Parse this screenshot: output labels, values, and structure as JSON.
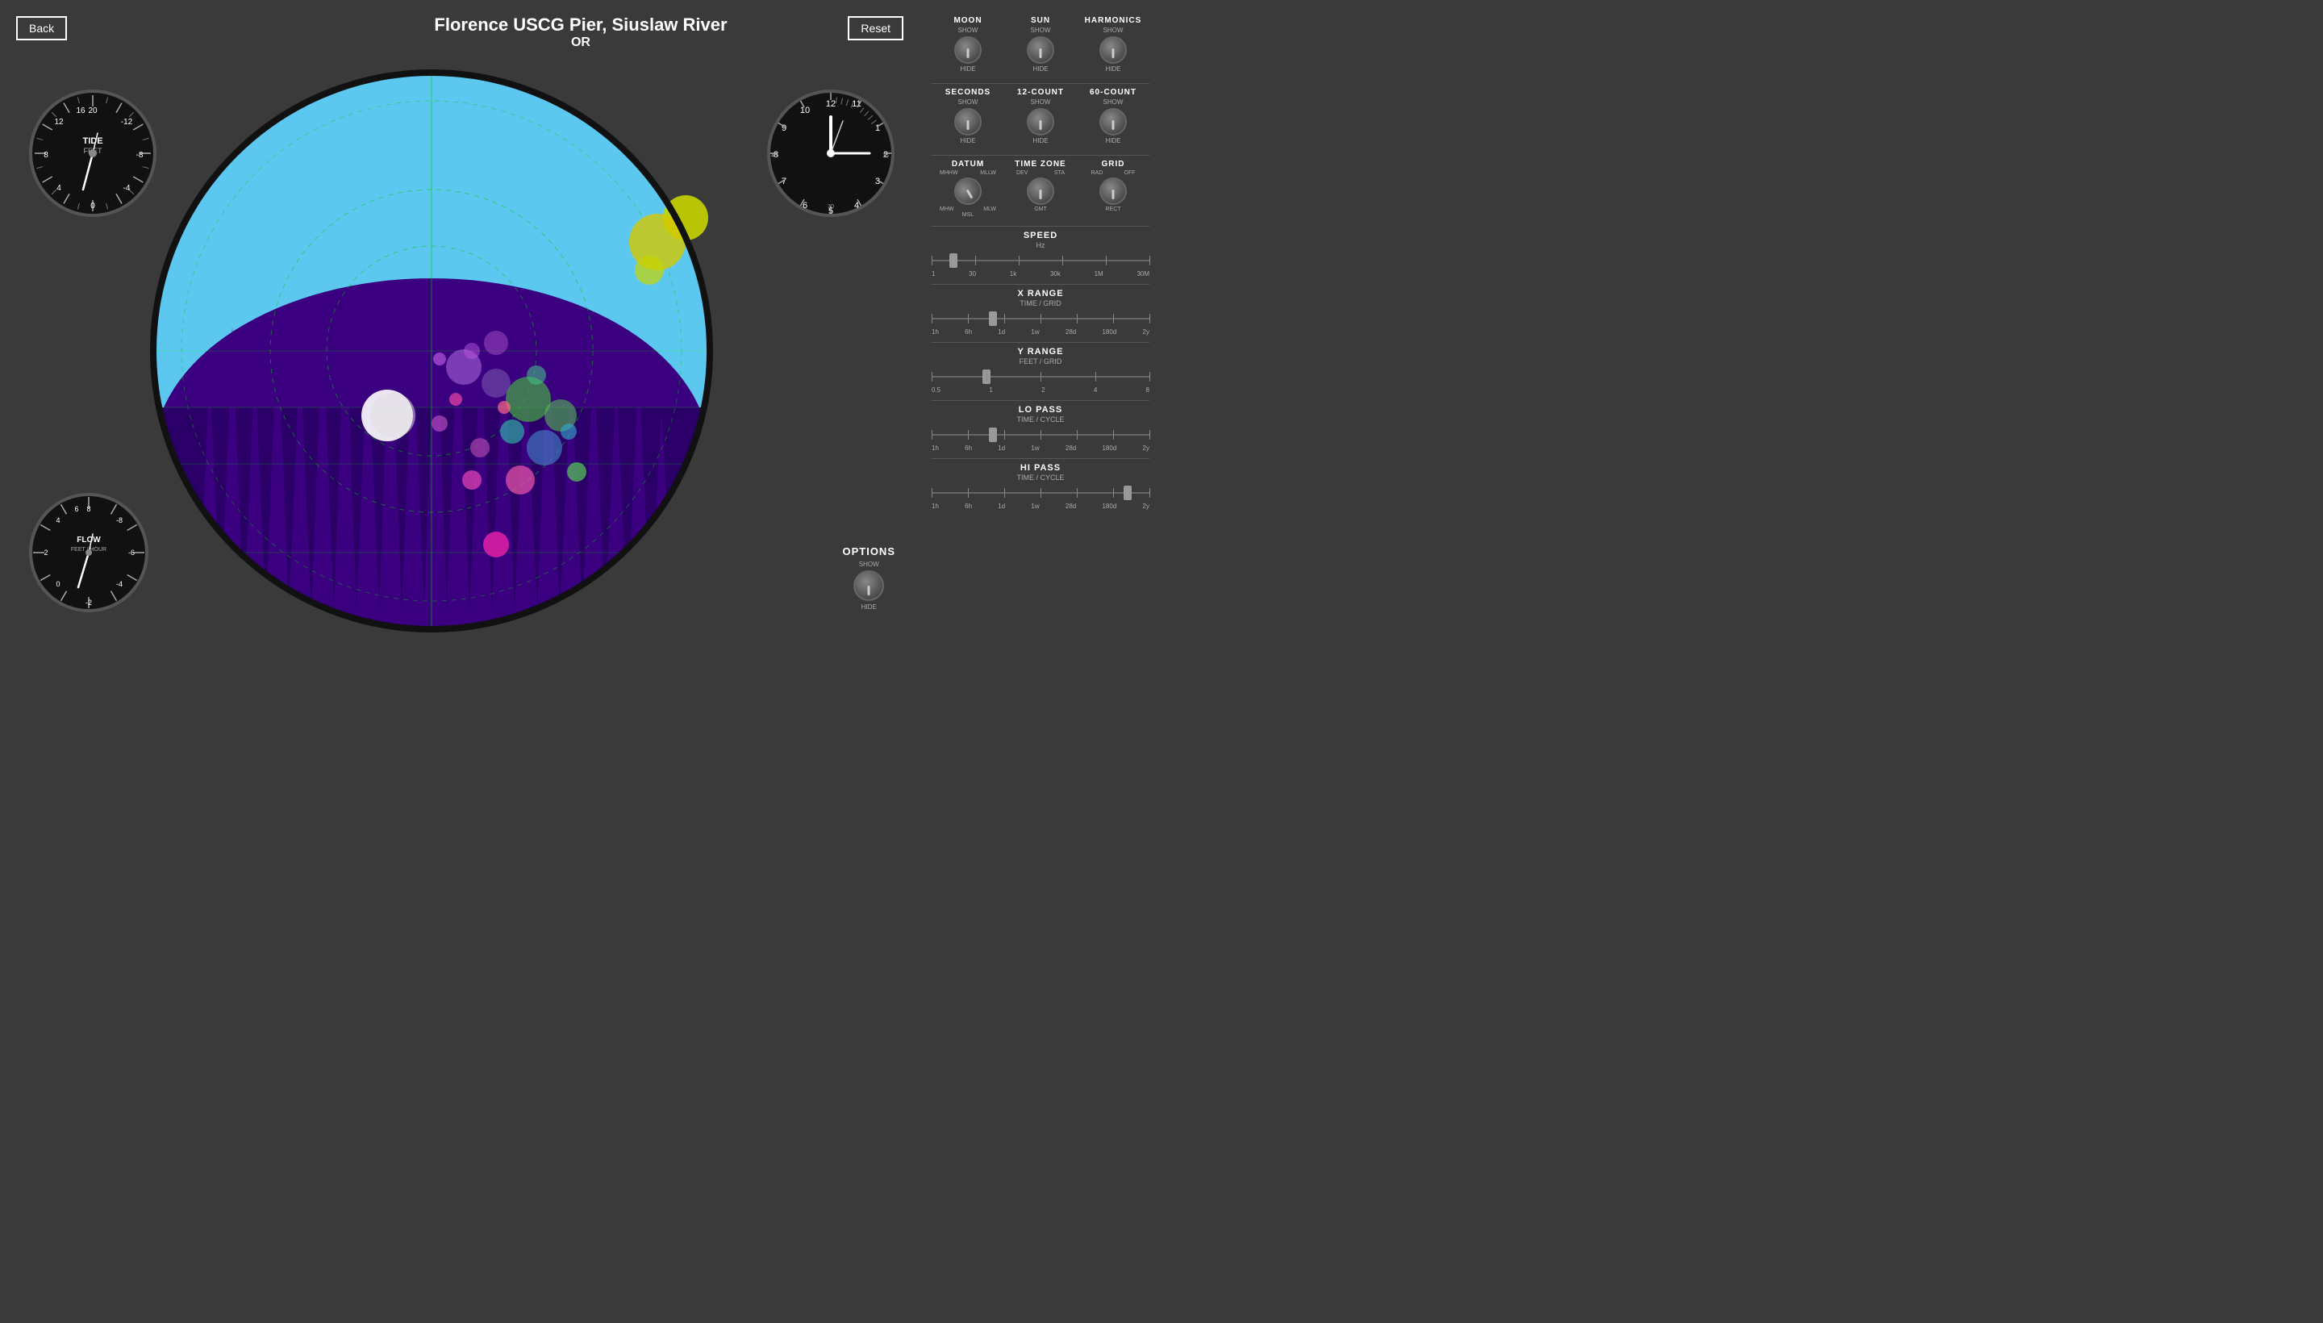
{
  "header": {
    "back_label": "Back",
    "reset_label": "Reset",
    "title_line1": "Florence USCG Pier, Siuslaw River",
    "title_line2": "OR"
  },
  "tide_gauge": {
    "label": "TIDE",
    "sublabel": "FEET",
    "values": [
      "20",
      "16",
      "12",
      "8",
      "4",
      "0",
      "-4",
      "-8",
      "-12"
    ]
  },
  "flow_gauge": {
    "label": "FLOW",
    "sublabel": "FEET / HOUR",
    "values": [
      "8",
      "6",
      "4",
      "2",
      "0",
      "-2",
      "-4",
      "-6",
      "-8"
    ]
  },
  "options": {
    "label": "OPTIONS",
    "show_label": "SHOW",
    "hide_label": "HIDE"
  },
  "right_panel": {
    "row1": [
      {
        "label": "MOON",
        "show": "SHOW",
        "hide": "HIDE"
      },
      {
        "label": "SUN",
        "show": "SHOW",
        "hide": "HIDE"
      },
      {
        "label": "HARMONICS",
        "show": "SHOW",
        "hide": "HIDE"
      }
    ],
    "row2": [
      {
        "label": "SECONDS",
        "show": "SHOW",
        "hide": "HIDE"
      },
      {
        "label": "12-COUNT",
        "show": "SHOW",
        "hide": "HIDE"
      },
      {
        "label": "60-COUNT",
        "show": "SHOW",
        "hide": "HIDE"
      }
    ],
    "datum": {
      "label": "DATUM",
      "positions": [
        "MHHW",
        "MHW",
        "MSL",
        "MLW",
        "MLLW"
      ]
    },
    "timezone": {
      "label": "TIME ZONE",
      "positions": [
        "DEV",
        "GMT",
        "STA"
      ]
    },
    "grid": {
      "label": "GRID",
      "positions": [
        "RAD",
        "RECT",
        "OFF"
      ]
    },
    "speed": {
      "label": "SPEED",
      "sublabel": "Hz",
      "ticks": [
        "1",
        "30",
        "1k",
        "30k",
        "1M",
        "30M"
      ],
      "thumb_pos": 0.1
    },
    "x_range": {
      "label": "X RANGE",
      "sublabel": "TIME / GRID",
      "ticks": [
        "1h",
        "6h",
        "1d",
        "1w",
        "28d",
        "180d",
        "2y"
      ],
      "thumb_pos": 0.28
    },
    "y_range": {
      "label": "Y RANGE",
      "sublabel": "FEET / GRID",
      "ticks": [
        "0.5",
        "1",
        "2",
        "4",
        "8"
      ],
      "thumb_pos": 0.25
    },
    "lo_pass": {
      "label": "LO PASS",
      "sublabel": "TIME / CYCLE",
      "ticks": [
        "1h",
        "6h",
        "1d",
        "1w",
        "28d",
        "180d",
        "2y"
      ],
      "thumb_pos": 0.28
    },
    "hi_pass": {
      "label": "HI PASS",
      "sublabel": "TIME / CYCLE",
      "ticks": [
        "1h",
        "6h",
        "1d",
        "1w",
        "28d",
        "180d",
        "2y"
      ],
      "thumb_pos": 0.9
    }
  }
}
